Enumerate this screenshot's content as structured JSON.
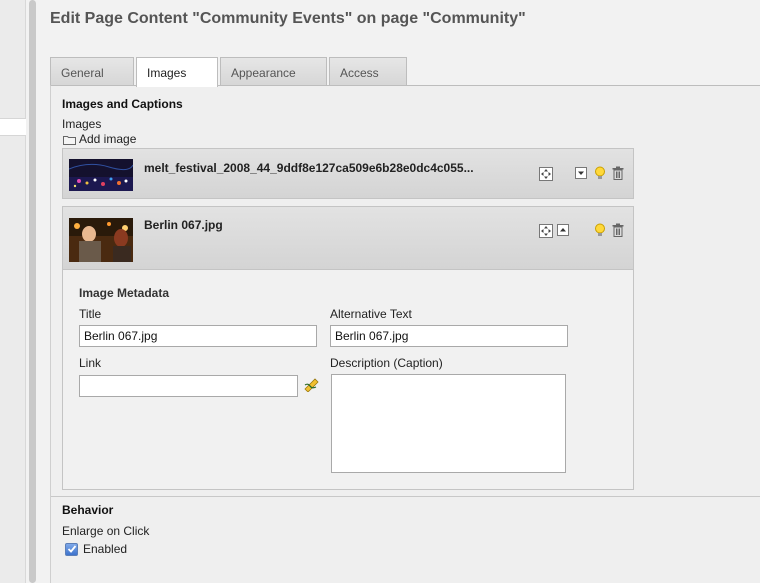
{
  "page_title": "Edit Page Content \"Community Events\" on page \"Community\"",
  "tabs": [
    {
      "label": "General"
    },
    {
      "label": "Images"
    },
    {
      "label": "Appearance"
    },
    {
      "label": "Access"
    }
  ],
  "images_section": {
    "title": "Images and Captions",
    "images_label": "Images",
    "add_image_label": "Add image",
    "items": [
      {
        "filename": "melt_festival_2008_44_9ddf8e127ca509e6b28e0dc4c055..."
      },
      {
        "filename": "Berlin 067.jpg"
      }
    ]
  },
  "metadata": {
    "heading": "Image Metadata",
    "title_label": "Title",
    "title_value": "Berlin 067.jpg",
    "alt_label": "Alternative Text",
    "alt_value": "Berlin 067.jpg",
    "link_label": "Link",
    "link_value": "",
    "description_label": "Description (Caption)",
    "description_value": ""
  },
  "behavior": {
    "title": "Behavior",
    "enlarge_label": "Enlarge on Click",
    "enabled_label": "Enabled",
    "enabled_checked": true
  },
  "icons": {
    "folder": "folder-icon",
    "move": "move-icon",
    "move_down": "move-down-icon",
    "move_up": "move-up-icon",
    "visibility": "lightbulb-icon",
    "delete": "trash-icon",
    "link_wizard": "link-wizard-icon"
  },
  "colors": {
    "title_text": "#555555",
    "checkbox_blue": "#3d73cc"
  }
}
